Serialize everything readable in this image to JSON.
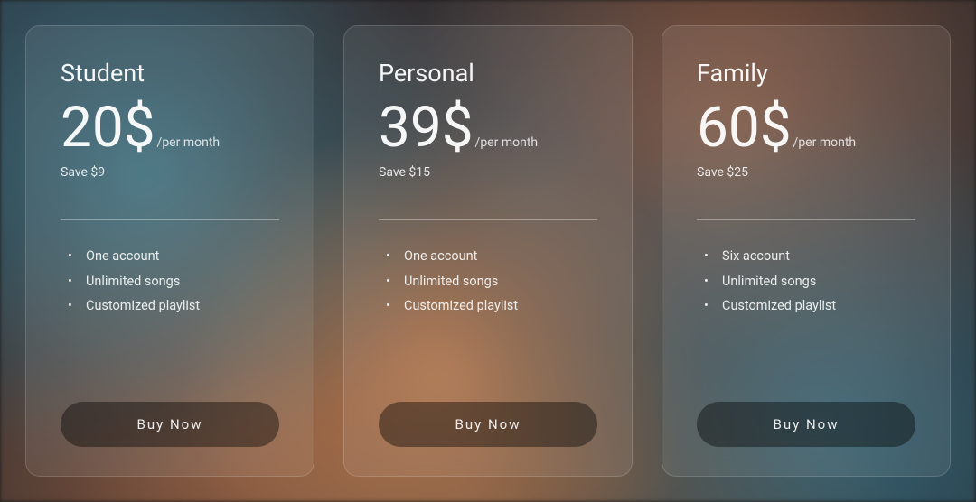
{
  "plans": [
    {
      "title": "Student",
      "price": "20$",
      "period": "/per month",
      "save": "Save $9",
      "features": [
        "One account",
        "Unlimited songs",
        "Customized playlist"
      ],
      "button": "Buy Now"
    },
    {
      "title": "Personal",
      "price": "39$",
      "period": "/per month",
      "save": "Save $15",
      "features": [
        "One account",
        "Unlimited songs",
        "Customized playlist"
      ],
      "button": "Buy Now"
    },
    {
      "title": "Family",
      "price": "60$",
      "period": "/per month",
      "save": "Save $25",
      "features": [
        "Six account",
        "Unlimited songs",
        "Customized playlist"
      ],
      "button": "Buy Now"
    }
  ]
}
